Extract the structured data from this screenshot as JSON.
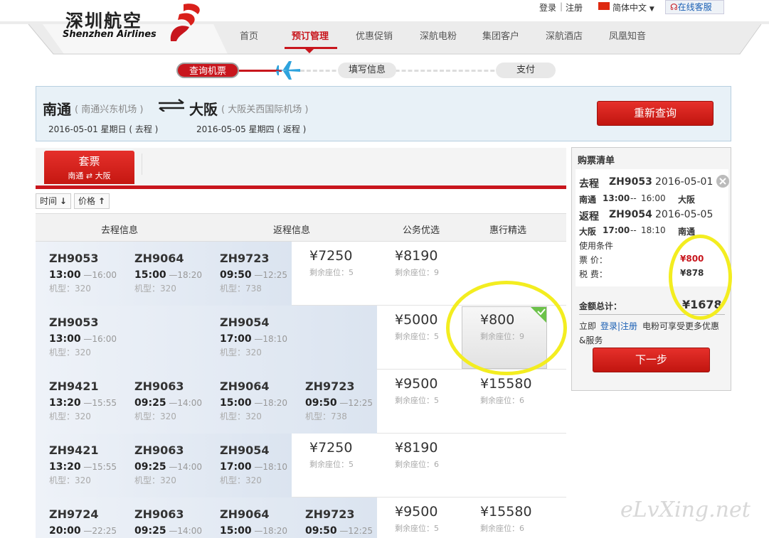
{
  "brand": {
    "name_cn": "深圳航空",
    "name_en": "Shenzhen Airlines"
  },
  "toplinks": {
    "login": "登录",
    "sep": "|",
    "register": "注册",
    "lang": "简体中文",
    "service": "在线客服"
  },
  "nav": [
    "首页",
    "预订管理",
    "优惠促销",
    "深航电粉",
    "集团客户",
    "深航酒店",
    "凤凰知音"
  ],
  "steps": [
    "查询机票",
    "填写信息",
    "支付"
  ],
  "search": {
    "from_city": "南通",
    "from_airport": "( 南通兴东机场 )",
    "to_city": "大阪",
    "to_airport": "( 大阪关西国际机场 )",
    "depart": "2016-05-01 星期日 ( 去程 )",
    "return": "2016-05-05 星期四 ( 返程 )",
    "requery": "重新查询"
  },
  "tab": {
    "title": "套票",
    "from": "南通",
    "to": "大阪"
  },
  "sort": {
    "time": "时间",
    "price": "价格"
  },
  "columns": [
    "去程信息",
    "返程信息",
    "公务优选",
    "惠行精选"
  ],
  "seat_prefix": "剩余座位：",
  "type_prefix": "机型：",
  "rows": [
    {
      "segs": [
        {
          "fn": "ZH9053",
          "dep": "13:00",
          "arr": "16:00",
          "type": "320"
        },
        {
          "fn": "ZH9064",
          "dep": "15:00",
          "arr": "18:20",
          "type": "320"
        },
        {
          "fn": "ZH9723",
          "dep": "09:50",
          "arr": "12:25",
          "type": "738"
        },
        null
      ],
      "prices": [
        {
          "v": "¥7250",
          "s": "5"
        },
        {
          "v": "¥8190",
          "s": "9"
        },
        null
      ]
    },
    {
      "segs": [
        {
          "fn": "ZH9053",
          "dep": "13:00",
          "arr": "16:00",
          "type": "320"
        },
        null,
        {
          "fn": "ZH9054",
          "dep": "17:00",
          "arr": "18:10",
          "type": "320"
        },
        null
      ],
      "prices": [
        null,
        {
          "v": "¥5000",
          "s": "5"
        },
        {
          "v": "¥800",
          "s": "9"
        }
      ]
    },
    {
      "segs": [
        {
          "fn": "ZH9421",
          "dep": "13:20",
          "arr": "15:55",
          "type": "320"
        },
        {
          "fn": "ZH9063",
          "dep": "09:25",
          "arr": "14:00",
          "type": "320"
        },
        {
          "fn": "ZH9064",
          "dep": "15:00",
          "arr": "18:20",
          "type": "320"
        },
        {
          "fn": "ZH9723",
          "dep": "09:50",
          "arr": "12:25",
          "type": "738"
        }
      ],
      "prices": [
        null,
        {
          "v": "¥9500",
          "s": "5"
        },
        {
          "v": "¥15580",
          "s": "6"
        }
      ]
    },
    {
      "segs": [
        {
          "fn": "ZH9421",
          "dep": "13:20",
          "arr": "15:55",
          "type": "320"
        },
        {
          "fn": "ZH9063",
          "dep": "09:25",
          "arr": "14:00",
          "type": "320"
        },
        {
          "fn": "ZH9054",
          "dep": "17:00",
          "arr": "18:10",
          "type": "320"
        },
        null
      ],
      "prices": [
        {
          "v": "¥7250",
          "s": "5"
        },
        {
          "v": "¥8190",
          "s": "6"
        },
        null
      ]
    },
    {
      "segs": [
        {
          "fn": "ZH9724",
          "dep": "20:00",
          "arr": "22:25",
          "type": ""
        },
        {
          "fn": "ZH9063",
          "dep": "09:25",
          "arr": "14:00",
          "type": ""
        },
        {
          "fn": "ZH9064",
          "dep": "15:00",
          "arr": "18:20",
          "type": ""
        },
        {
          "fn": "ZH9723",
          "dep": "09:50",
          "arr": "12:25",
          "type": ""
        }
      ],
      "prices": [
        null,
        {
          "v": "¥9500",
          "s": "5"
        },
        {
          "v": "¥15580",
          "s": "6"
        }
      ]
    }
  ],
  "cart": {
    "title": "购票清单",
    "out": {
      "label": "去程",
      "fn": "ZH9053",
      "date": "2016-05-01",
      "from": "南通",
      "dep": "13:00",
      "sep": "--",
      "arr": "16:00",
      "to": "大阪"
    },
    "ret": {
      "label": "返程",
      "fn": "ZH9054",
      "date": "2016-05-05",
      "from": "大阪",
      "dep": "17:00",
      "sep": "--",
      "arr": "18:10",
      "to": "南通"
    },
    "conditions": "使用条件",
    "fare_label": "票 价：",
    "fare": "¥800",
    "tax_label": "税 费：",
    "tax": "¥878",
    "total_label": "金额总计：",
    "total": "¥1678",
    "promo_pre": "立即",
    "promo_login": "登录|注册",
    "promo_post": "电粉可享受更多优惠",
    "promo_tail": "&服务",
    "next": "下一步"
  },
  "watermark": "eLvXing.net",
  "colors": {
    "brand_red": "#c8161d",
    "highlight": "#f3ed20",
    "link_blue": "#1a5fb4"
  }
}
